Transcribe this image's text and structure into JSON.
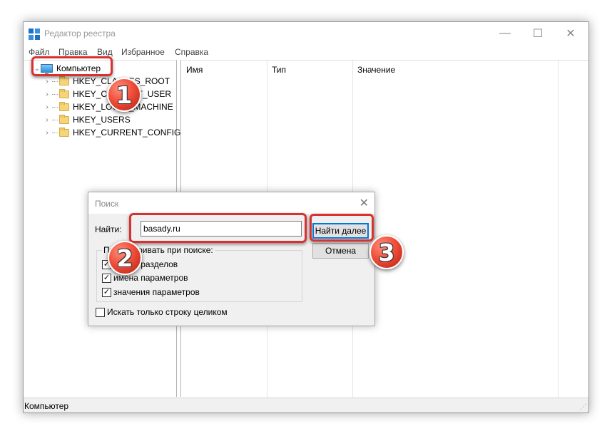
{
  "window": {
    "title": "Редактор реестра",
    "minimize": "—",
    "maximize": "☐",
    "close": "✕"
  },
  "menu": {
    "items": [
      "Файл",
      "Правка",
      "Вид",
      "Избранное",
      "Справка"
    ]
  },
  "tree": {
    "root": "Компьютер",
    "items": [
      "HKEY_CLASSES_ROOT",
      "HKEY_CURRENT_USER",
      "HKEY_LOCAL_MACHINE",
      "HKEY_USERS",
      "HKEY_CURRENT_CONFIG"
    ]
  },
  "columns": [
    "Имя",
    "Тип",
    "Значение"
  ],
  "status": {
    "text": "Компьютер"
  },
  "dialog": {
    "title": "Поиск",
    "close": "✕",
    "find_label": "Найти:",
    "find_value": "basady.ru",
    "find_next": "Найти далее",
    "cancel": "Отмена",
    "group_label": "Просматривать при поиске:",
    "options": [
      {
        "label": "имена разделов",
        "checked": true
      },
      {
        "label": "имена параметров",
        "checked": true
      },
      {
        "label": "значения параметров",
        "checked": true
      }
    ],
    "whole_string": {
      "label": "Искать только строку целиком",
      "checked": false
    }
  },
  "callouts": [
    "1",
    "2",
    "3"
  ],
  "colors": {
    "highlight": "#d93030",
    "badge": "#f04e3a",
    "accent": "#0078d7"
  }
}
